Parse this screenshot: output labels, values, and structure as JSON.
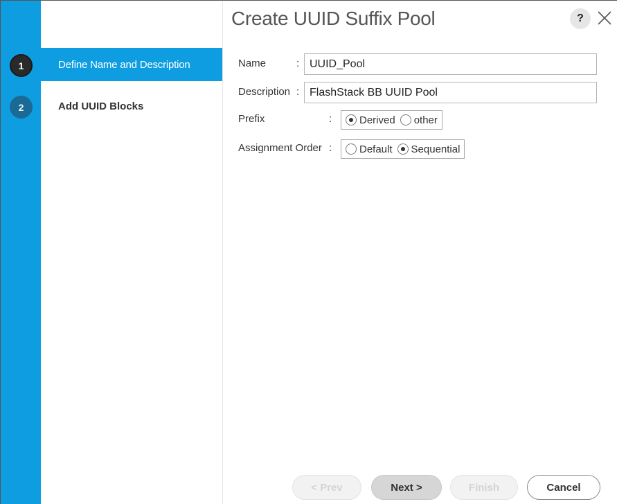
{
  "dialog": {
    "title": "Create UUID Suffix Pool",
    "help_label": "?"
  },
  "steps": [
    {
      "number": "1",
      "label": "Define Name and Description",
      "active": true
    },
    {
      "number": "2",
      "label": "Add UUID Blocks",
      "active": false
    }
  ],
  "form": {
    "name": {
      "label": "Name",
      "separator": ":",
      "value": "UUID_Pool"
    },
    "description": {
      "label": "Description",
      "separator": ":",
      "value": "FlashStack BB UUID Pool"
    },
    "prefix": {
      "label": "Prefix",
      "separator": ":",
      "options": [
        "Derived",
        "other"
      ],
      "selected": "Derived"
    },
    "assignment_order": {
      "label": "Assignment Order",
      "separator": ":",
      "options": [
        "Default",
        "Sequential"
      ],
      "selected": "Sequential"
    }
  },
  "footer": {
    "prev_label": "< Prev",
    "next_label": "Next >",
    "finish_label": "Finish",
    "cancel_label": "Cancel"
  },
  "colors": {
    "accent_blue": "#0d9de0",
    "active_step_circle": "#2a2a2a",
    "inactive_step_circle": "#1b6a96"
  }
}
